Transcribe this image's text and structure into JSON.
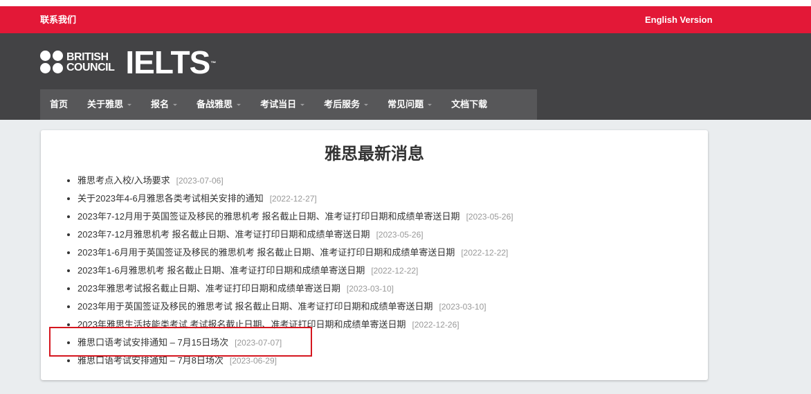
{
  "topbar": {
    "contact": "联系我们",
    "english": "English Version"
  },
  "logo": {
    "bc_line1": "BRITISH",
    "bc_line2": "COUNCIL",
    "ielts": "IELTS",
    "tm": "™"
  },
  "nav": [
    {
      "label": "首页",
      "dropdown": false
    },
    {
      "label": "关于雅思",
      "dropdown": true
    },
    {
      "label": "报名",
      "dropdown": true
    },
    {
      "label": "备战雅思",
      "dropdown": true
    },
    {
      "label": "考试当日",
      "dropdown": true
    },
    {
      "label": "考后服务",
      "dropdown": true
    },
    {
      "label": "常见问题",
      "dropdown": true
    },
    {
      "label": "文档下载",
      "dropdown": false
    }
  ],
  "main": {
    "title": "雅思最新消息",
    "news": [
      {
        "title": "雅思考点入校/入场要求",
        "date": "[2023-07-06]"
      },
      {
        "title": "关于2023年4-6月雅思各类考试相关安排的通知",
        "date": "[2022-12-27]"
      },
      {
        "title": "2023年7-12月用于英国签证及移民的雅思机考 报名截止日期、准考证打印日期和成绩单寄送日期",
        "date": "[2023-05-26]"
      },
      {
        "title": "2023年7-12月雅思机考 报名截止日期、准考证打印日期和成绩单寄送日期",
        "date": "[2023-05-26]"
      },
      {
        "title": "2023年1-6月用于英国签证及移民的雅思机考 报名截止日期、准考证打印日期和成绩单寄送日期",
        "date": "[2022-12-22]"
      },
      {
        "title": "2023年1-6月雅思机考 报名截止日期、准考证打印日期和成绩单寄送日期",
        "date": "[2022-12-22]"
      },
      {
        "title": "2023年雅思考试报名截止日期、准考证打印日期和成绩单寄送日期",
        "date": "[2023-03-10]"
      },
      {
        "title": "2023年用于英国签证及移民的雅思考试 报名截止日期、准考证打印日期和成绩单寄送日期",
        "date": "[2023-03-10]"
      },
      {
        "title": "2023年雅思生活技能类考试 考试报名截止日期、准考证打印日期和成绩单寄送日期",
        "date": "[2022-12-26]"
      },
      {
        "title": "雅思口语考试安排通知 – 7月15日场次",
        "date": "[2023-07-07]"
      },
      {
        "title": "雅思口语考试安排通知 – 7月8日场次",
        "date": "[2023-06-29]"
      }
    ]
  },
  "colors": {
    "topbar": "#e31837",
    "header": "#434345",
    "nav": "#575759",
    "highlight": "#d5161f"
  }
}
